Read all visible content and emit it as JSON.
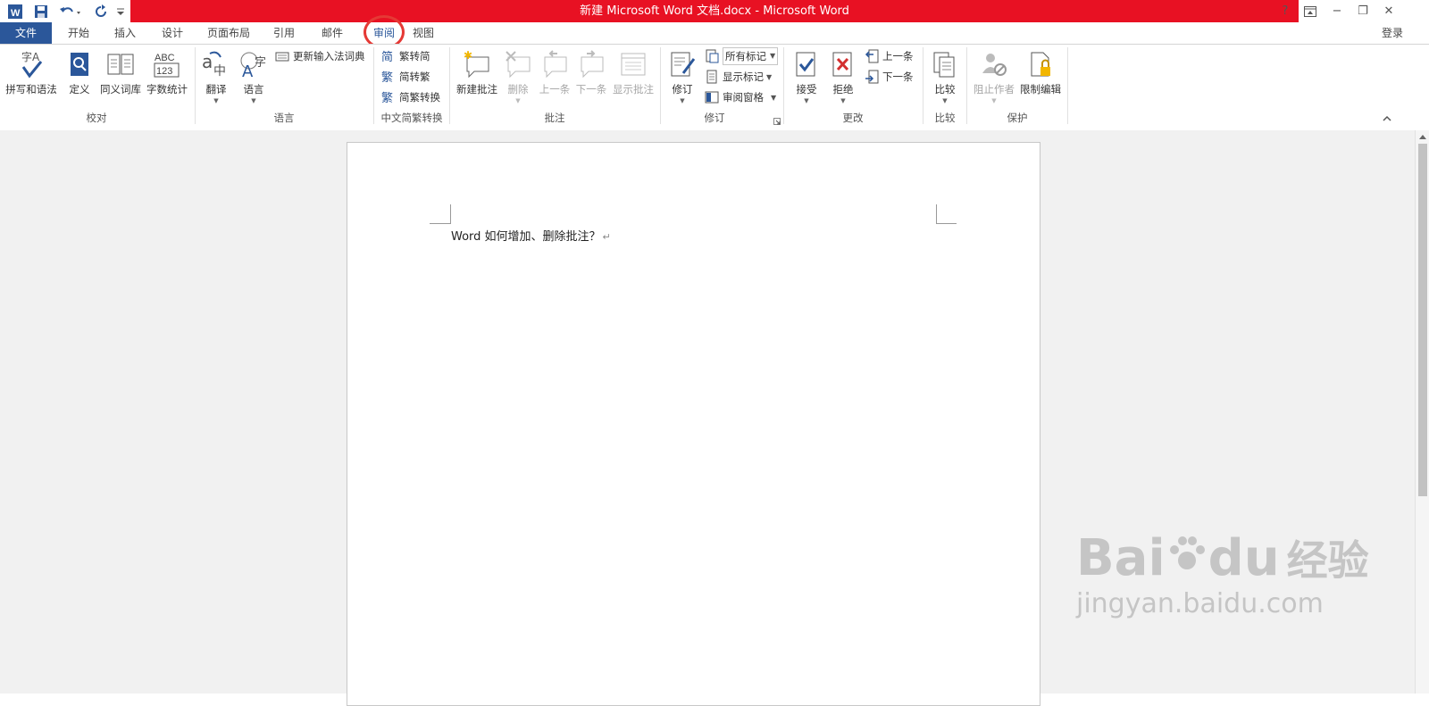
{
  "title_bar": {
    "title": "新建 Microsoft Word 文档.docx - Microsoft Word",
    "help": "?",
    "minimize": "−",
    "restore": "❐",
    "close": "✕"
  },
  "qat": {
    "icons": [
      "word-logo-icon",
      "save-icon",
      "undo-icon",
      "redo-icon",
      "customize-qat-icon"
    ]
  },
  "account": {
    "login": "登录"
  },
  "tabs": [
    "文件",
    "开始",
    "插入",
    "设计",
    "页面布局",
    "引用",
    "邮件",
    "审阅",
    "视图"
  ],
  "active_tab": "审阅",
  "ribbon": {
    "proofing": {
      "label": "校对",
      "spell": "拼写和语法",
      "define": "定义",
      "thesaurus": "同义词库",
      "wordcount": "字数统计"
    },
    "language": {
      "label": "语言",
      "translate": "翻译",
      "language": "语言",
      "update_ime": "更新输入法词典"
    },
    "chinese": {
      "label": "中文简繁转换",
      "t2s": "繁转简",
      "s2t": "简转繁",
      "convert": "简繁转换"
    },
    "comments": {
      "label": "批注",
      "new": "新建批注",
      "delete": "删除",
      "prev": "上一条",
      "next": "下一条",
      "show": "显示批注"
    },
    "tracking": {
      "label": "修订",
      "track": "修订",
      "markup_select": "所有标记",
      "show_markup": "显示标记",
      "pane": "审阅窗格"
    },
    "changes": {
      "label": "更改",
      "accept": "接受",
      "reject": "拒绝",
      "prev": "上一条",
      "next": "下一条"
    },
    "compare": {
      "label": "比较",
      "compare": "比较"
    },
    "protect": {
      "label": "保护",
      "block": "阻止作者",
      "restrict": "限制编辑"
    }
  },
  "document": {
    "text": "Word 如何增加、删除批注？",
    "para_mark": "↵"
  },
  "watermark": {
    "brand": "Bai",
    "brand2": "du",
    "cn": "经验",
    "url": "jingyan.baidu.com"
  },
  "colors": {
    "title_red": "#e81123",
    "file_tab": "#2b579a",
    "highlight_circle": "#e53935"
  }
}
